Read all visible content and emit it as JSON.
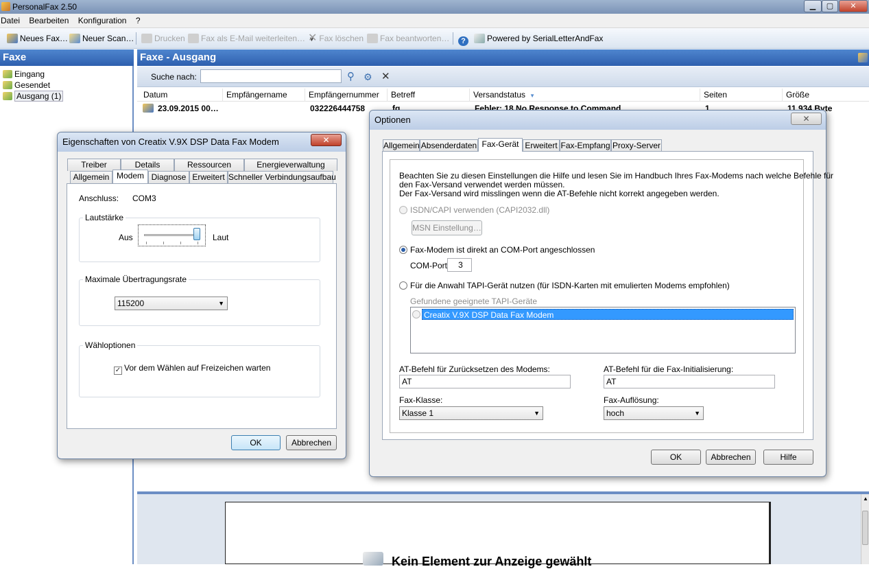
{
  "window": {
    "title": "PersonalFax 2.50",
    "min_label": "▁",
    "max_label": "▢",
    "close_label": "✕"
  },
  "menu": [
    "Datei",
    "Bearbeiten",
    "Konfiguration",
    "?"
  ],
  "toolbar": {
    "new_fax": "Neues Fax…",
    "new_scan": "Neuer Scan…",
    "print": "Drucken",
    "forward_email": "Fax als E-Mail weiterleiten…",
    "delete_fax": "Fax löschen",
    "reply_fax": "Fax beantworten…",
    "powered": "Powered by SerialLetterAndFax"
  },
  "left": {
    "header": "Faxe",
    "items": [
      "Eingang",
      "Gesendet",
      "Ausgang (1)"
    ]
  },
  "right": {
    "header": "Faxe - Ausgang",
    "search_label": "Suche nach:",
    "search_value": "",
    "columns": [
      "Datum",
      "Empfängername",
      "Empfängernummer",
      "Betreff",
      "Versandstatus",
      "Seiten",
      "Größe"
    ],
    "rows": [
      {
        "datum": "23.09.2015 00…",
        "name": "",
        "nummer": "032226444758",
        "betreff": "fg",
        "status": "Fehler: 18 No Response to Command",
        "seiten": "1",
        "groesse": "11.934 Byte"
      }
    ],
    "preview_text": "Kein Element zur Anzeige gewählt"
  },
  "modem_dialog": {
    "title": "Eigenschaften von Creatix V.9X DSP Data Fax Modem",
    "close_label": "✕",
    "tabs_row1": [
      "Treiber",
      "Details",
      "Ressourcen",
      "Energieverwaltung"
    ],
    "tabs_row2": [
      "Allgemein",
      "Modem",
      "Diagnose",
      "Erweitert",
      "Schneller Verbindungsaufbau"
    ],
    "port_label": "Anschluss:",
    "port_value": "COM3",
    "volume_group": "Lautstärke",
    "volume_min": "Aus",
    "volume_max": "Laut",
    "volume_level": 1.0,
    "rate_group": "Maximale Übertragungsrate",
    "rate_value": "115200",
    "dial_group": "Wähloptionen",
    "dial_check": "Vor dem Wählen auf Freizeichen warten",
    "dial_checked": true,
    "ok": "OK",
    "cancel": "Abbrechen"
  },
  "options_dialog": {
    "title": "Optionen",
    "close_label": "✕",
    "tabs": [
      "Allgemein",
      "Absenderdaten",
      "Fax-Gerät",
      "Erweitert",
      "Fax-Empfang",
      "Proxy-Server"
    ],
    "info_line1": "Beachten Sie zu diesen Einstellungen die Hilfe und lesen Sie im Handbuch Ihres Fax-Modems nach welche Befehle für",
    "info_line2": "den Fax-Versand verwendet werden müssen.",
    "info_line3": "Der Fax-Versand wird misslingen wenn die AT-Befehle nicht korrekt angegeben werden.",
    "isdn_label": "ISDN/CAPI verwenden (CAPI2032.dll)",
    "msn_button": "MSN Einstellung…",
    "com_label": "Fax-Modem ist direkt an COM-Port angeschlossen",
    "com_port_label": "COM-Port:",
    "com_port_value": "3",
    "tapi_label": "Für die Anwahl TAPI-Gerät nutzen (für ISDN-Karten mit emulierten Modems empfohlen)",
    "tapi_devices_label": "Gefundene geeignete TAPI-Geräte",
    "tapi_device": "Creatix V.9X DSP Data Fax Modem",
    "at_reset_label": "AT-Befehl für Zurücksetzen des Modems:",
    "at_reset_value": "AT",
    "at_init_label": "AT-Befehl für die Fax-Initialisierung:",
    "at_init_value": "AT",
    "class_label": "Fax-Klasse:",
    "class_value": "Klasse 1",
    "resolution_label": "Fax-Auflösung:",
    "resolution_value": "hoch",
    "ok": "OK",
    "cancel": "Abbrechen",
    "help": "Hilfe"
  },
  "colors": {
    "header_blue": "#2e5fae",
    "selection_blue": "#3399ff"
  }
}
